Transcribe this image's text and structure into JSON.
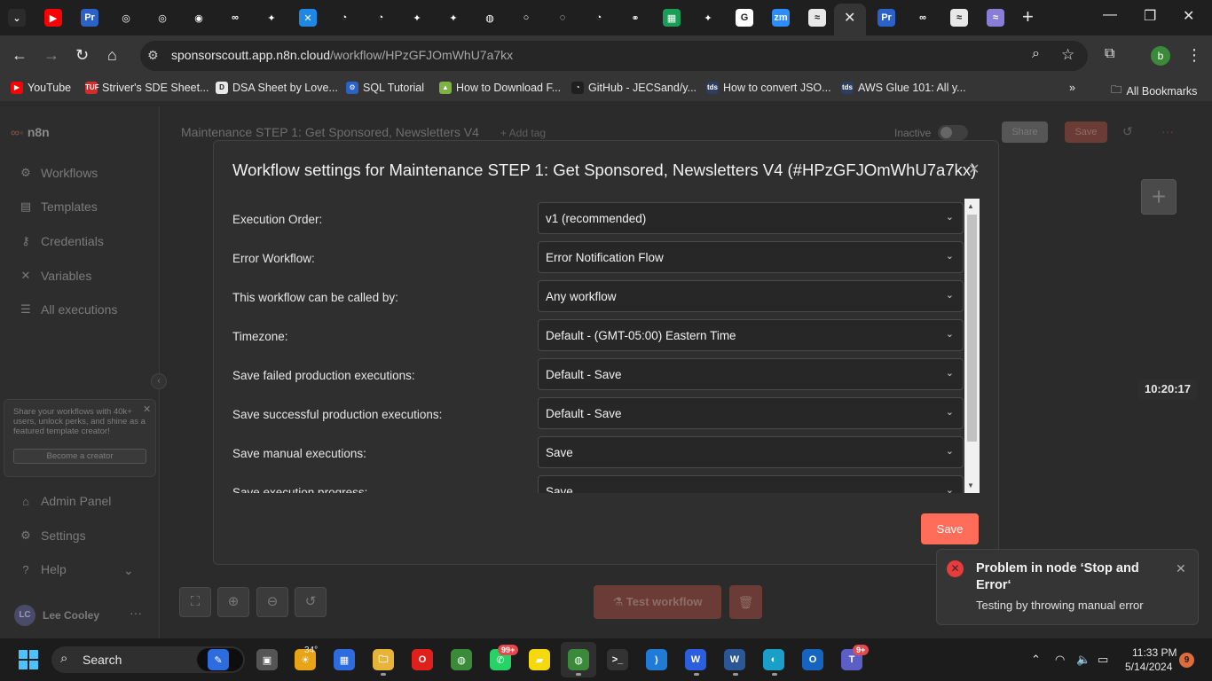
{
  "browser": {
    "url_host": "sponsorscoutt.app.n8n.cloud",
    "url_path": "/workflow/HPzGFJOmWhU7a7kx",
    "tab_icons": [
      {
        "name": "tab-search-icon",
        "color": "#2b2b2b",
        "glyph": "⌄"
      },
      {
        "name": "youtube-tab-icon",
        "color": "#ff0000",
        "glyph": "▶"
      },
      {
        "name": "premiere-tab-icon",
        "color": "#2a62c8",
        "glyph": "Pr"
      },
      {
        "name": "chatgpt-tab-icon",
        "color": "#1f1f1f",
        "glyph": "◎"
      },
      {
        "name": "chatgpt-tab-icon",
        "color": "#1f1f1f",
        "glyph": "◎"
      },
      {
        "name": "app-tab-icon",
        "color": "#1f1f1f",
        "glyph": "◉"
      },
      {
        "name": "n8n-tab-icon",
        "color": "#1f1f1f",
        "glyph": "∞"
      },
      {
        "name": "openai-tab-icon",
        "color": "#1f1f1f",
        "glyph": "✦"
      },
      {
        "name": "make-tab-icon",
        "color": "#1e88e5",
        "glyph": "✕"
      },
      {
        "name": "github-tab-icon",
        "color": "#1f1f1f",
        "glyph": "◔"
      },
      {
        "name": "github-tab-icon",
        "color": "#1f1f1f",
        "glyph": "◔"
      },
      {
        "name": "openai-tab-icon",
        "color": "#1f1f1f",
        "glyph": "✦"
      },
      {
        "name": "openai-tab-icon",
        "color": "#1f1f1f",
        "glyph": "✦"
      },
      {
        "name": "chrome-tab-icon",
        "color": "#1f1f1f",
        "glyph": "◍"
      },
      {
        "name": "loading-tab-icon",
        "color": "#1f1f1f",
        "glyph": "○"
      },
      {
        "name": "loading-tab-icon",
        "color": "#1f1f1f",
        "glyph": "◌"
      },
      {
        "name": "github-tab-icon",
        "color": "#1f1f1f",
        "glyph": "◔"
      },
      {
        "name": "link-tab-icon",
        "color": "#1f1f1f",
        "glyph": "⚭"
      },
      {
        "name": "sheets-tab-icon",
        "color": "#1a9e57",
        "glyph": "▦"
      },
      {
        "name": "openai-tab-icon",
        "color": "#1f1f1f",
        "glyph": "✦"
      },
      {
        "name": "google-tab-icon",
        "color": "#ffffff",
        "glyph": "G"
      },
      {
        "name": "zoom-tab-icon",
        "color": "#2d8cff",
        "glyph": "zm"
      },
      {
        "name": "n8n-tab-icon",
        "color": "#e8e8e8",
        "glyph": "≈"
      }
    ],
    "tab_icons_right": [
      {
        "name": "premiere-tab-icon",
        "color": "#2a62c8",
        "glyph": "Pr"
      },
      {
        "name": "n8n-tab-icon",
        "color": "#1f1f1f",
        "glyph": "∞"
      },
      {
        "name": "n8n-tab-icon",
        "color": "#e8e8e8",
        "glyph": "≈"
      },
      {
        "name": "n8n-tab-icon",
        "color": "#8a7dd8",
        "glyph": "≈"
      }
    ],
    "bookmarks": [
      {
        "label": "YouTube",
        "icon": "youtube-icon",
        "color": "#ff0000",
        "glyph": "▶"
      },
      {
        "label": "Striver's SDE Sheet...",
        "icon": "tuf-icon",
        "color": "#d62b2b",
        "glyph": "TUF"
      },
      {
        "label": "DSA Sheet by Love...",
        "icon": "dsa-icon",
        "color": "#e8e8e8",
        "glyph": "D"
      },
      {
        "label": "SQL Tutorial",
        "icon": "sql-icon",
        "color": "#2a62c8",
        "glyph": "⚙"
      },
      {
        "label": "How to Download F...",
        "icon": "android-icon",
        "color": "#7cb342",
        "glyph": "▲"
      },
      {
        "label": "GitHub - JECSand/y...",
        "icon": "github-icon",
        "color": "#1f1f1f",
        "glyph": "◔"
      },
      {
        "label": "How to convert JSO...",
        "icon": "tds-icon",
        "color": "#2d3d5e",
        "glyph": "tds"
      },
      {
        "label": "AWS Glue 101: All y...",
        "icon": "tds-icon",
        "color": "#2d3d5e",
        "glyph": "tds"
      }
    ],
    "all_bookmarks": "All Bookmarks",
    "profile_initial": "b"
  },
  "app": {
    "logo": "n8n",
    "sidebar": {
      "items": [
        {
          "label": "Workflows",
          "icon": "workflows-icon",
          "glyph": "⚙"
        },
        {
          "label": "Templates",
          "icon": "templates-icon",
          "glyph": "▤"
        },
        {
          "label": "Credentials",
          "icon": "key-icon",
          "glyph": "⚷"
        },
        {
          "label": "Variables",
          "icon": "variables-icon",
          "glyph": "✕"
        },
        {
          "label": "All executions",
          "icon": "list-icon",
          "glyph": "☰"
        }
      ],
      "promo_text": "Share your workflows with 40k+ users, unlock perks, and shine as a featured template creator!",
      "promo_button": "Become a creator",
      "bottom_items": [
        {
          "label": "Admin Panel",
          "icon": "home-icon",
          "glyph": "⌂"
        },
        {
          "label": "Settings",
          "icon": "gear-icon",
          "glyph": "⚙"
        },
        {
          "label": "Help",
          "icon": "help-icon",
          "glyph": "?"
        }
      ],
      "user_initials": "LC",
      "user_name": "Lee Cooley"
    },
    "header": {
      "workflow_title": "Maintenance STEP 1: Get Sponsored, Newsletters V4",
      "add_tag": "+ Add tag",
      "status": "Inactive",
      "share": "Share",
      "save": "Save"
    },
    "canvas": {
      "clock": "10:20:17",
      "test_workflow": "Test workflow"
    }
  },
  "modal": {
    "title": "Workflow settings for Maintenance STEP 1: Get Sponsored, Newsletters V4 (#HPzGFJOmWhU7a7kx)",
    "rows": [
      {
        "label": "Execution Order:",
        "value": "v1 (recommended)"
      },
      {
        "label": "Error Workflow:",
        "value": "Error Notification Flow"
      },
      {
        "label": "This workflow can be called by:",
        "value": "Any workflow"
      },
      {
        "label": "Timezone:",
        "value": "Default - (GMT-05:00) Eastern Time"
      },
      {
        "label": "Save failed production executions:",
        "value": "Default - Save"
      },
      {
        "label": "Save successful production executions:",
        "value": "Default - Save"
      },
      {
        "label": "Save manual executions:",
        "value": "Save"
      },
      {
        "label": "Save execution progress:",
        "value": "Save"
      }
    ],
    "save": "Save"
  },
  "toast": {
    "title": "Problem in node ‘Stop and Error‘",
    "message": "Testing by throwing manual error"
  },
  "taskbar": {
    "search": "Search",
    "weather_temp": "34°",
    "whatsapp_badge": "99+",
    "teams_badge": "9+",
    "time": "11:33 PM",
    "date": "5/14/2024",
    "notifications": "9"
  },
  "colors": {
    "accent": "#ff6d5a",
    "error": "#e83b3b"
  }
}
